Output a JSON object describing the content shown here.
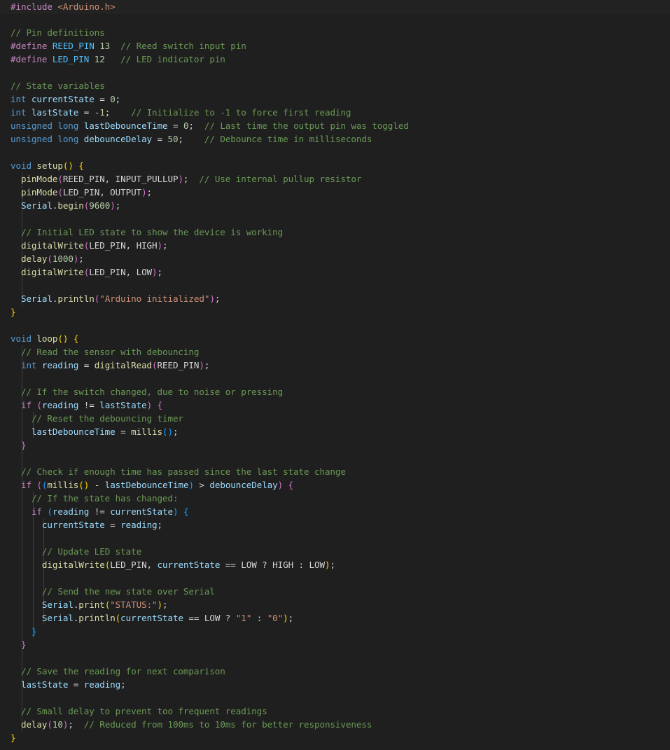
{
  "editor": {
    "file_language": "cpp",
    "lines": [
      [
        [
          "pp",
          "#include "
        ],
        [
          "str",
          "<Arduino.h>"
        ]
      ],
      [],
      [
        [
          "cm",
          "// Pin definitions"
        ]
      ],
      [
        [
          "pp",
          "#define "
        ],
        [
          "def",
          "REED_PIN"
        ],
        [
          "plain",
          " "
        ],
        [
          "num",
          "13"
        ],
        [
          "plain",
          "  "
        ],
        [
          "cm",
          "// Reed switch input pin"
        ]
      ],
      [
        [
          "pp",
          "#define "
        ],
        [
          "def",
          "LED_PIN"
        ],
        [
          "plain",
          " "
        ],
        [
          "num",
          "12"
        ],
        [
          "plain",
          "   "
        ],
        [
          "cm",
          "// LED indicator pin"
        ]
      ],
      [],
      [
        [
          "cm",
          "// State variables"
        ]
      ],
      [
        [
          "kw",
          "int"
        ],
        [
          "plain",
          " "
        ],
        [
          "var",
          "currentState"
        ],
        [
          "plain",
          " = "
        ],
        [
          "num",
          "0"
        ],
        [
          "plain",
          ";"
        ]
      ],
      [
        [
          "kw",
          "int"
        ],
        [
          "plain",
          " "
        ],
        [
          "var",
          "lastState"
        ],
        [
          "plain",
          " = -"
        ],
        [
          "num",
          "1"
        ],
        [
          "plain",
          ";    "
        ],
        [
          "cm",
          "// Initialize to -1 to force first reading"
        ]
      ],
      [
        [
          "kw",
          "unsigned long"
        ],
        [
          "plain",
          " "
        ],
        [
          "var",
          "lastDebounceTime"
        ],
        [
          "plain",
          " = "
        ],
        [
          "num",
          "0"
        ],
        [
          "plain",
          ";  "
        ],
        [
          "cm",
          "// Last time the output pin was toggled"
        ]
      ],
      [
        [
          "kw",
          "unsigned long"
        ],
        [
          "plain",
          " "
        ],
        [
          "var",
          "debounceDelay"
        ],
        [
          "plain",
          " = "
        ],
        [
          "num",
          "50"
        ],
        [
          "plain",
          ";    "
        ],
        [
          "cm",
          "// Debounce time in milliseconds"
        ]
      ],
      [],
      [
        [
          "kw",
          "void"
        ],
        [
          "plain",
          " "
        ],
        [
          "fn",
          "setup"
        ],
        [
          "p1",
          "()"
        ],
        [
          "plain",
          " "
        ],
        [
          "p1",
          "{"
        ]
      ],
      [
        [
          "plain",
          "  "
        ],
        [
          "fn",
          "pinMode"
        ],
        [
          "p2",
          "("
        ],
        [
          "plain",
          "REED_PIN, INPUT_PULLUP"
        ],
        [
          "p2",
          ")"
        ],
        [
          "plain",
          ";  "
        ],
        [
          "cm",
          "// Use internal pullup resistor"
        ]
      ],
      [
        [
          "plain",
          "  "
        ],
        [
          "fn",
          "pinMode"
        ],
        [
          "p2",
          "("
        ],
        [
          "plain",
          "LED_PIN, OUTPUT"
        ],
        [
          "p2",
          ")"
        ],
        [
          "plain",
          ";"
        ]
      ],
      [
        [
          "plain",
          "  "
        ],
        [
          "var",
          "Serial"
        ],
        [
          "plain",
          "."
        ],
        [
          "fn",
          "begin"
        ],
        [
          "p2",
          "("
        ],
        [
          "num",
          "9600"
        ],
        [
          "p2",
          ")"
        ],
        [
          "plain",
          ";"
        ]
      ],
      [],
      [
        [
          "plain",
          "  "
        ],
        [
          "cm",
          "// Initial LED state to show the device is working"
        ]
      ],
      [
        [
          "plain",
          "  "
        ],
        [
          "fn",
          "digitalWrite"
        ],
        [
          "p2",
          "("
        ],
        [
          "plain",
          "LED_PIN, HIGH"
        ],
        [
          "p2",
          ")"
        ],
        [
          "plain",
          ";"
        ]
      ],
      [
        [
          "plain",
          "  "
        ],
        [
          "fn",
          "delay"
        ],
        [
          "p2",
          "("
        ],
        [
          "num",
          "1000"
        ],
        [
          "p2",
          ")"
        ],
        [
          "plain",
          ";"
        ]
      ],
      [
        [
          "plain",
          "  "
        ],
        [
          "fn",
          "digitalWrite"
        ],
        [
          "p2",
          "("
        ],
        [
          "plain",
          "LED_PIN, LOW"
        ],
        [
          "p2",
          ")"
        ],
        [
          "plain",
          ";"
        ]
      ],
      [],
      [
        [
          "plain",
          "  "
        ],
        [
          "var",
          "Serial"
        ],
        [
          "plain",
          "."
        ],
        [
          "fn",
          "println"
        ],
        [
          "p2",
          "("
        ],
        [
          "str",
          "\"Arduino initialized\""
        ],
        [
          "p2",
          ")"
        ],
        [
          "plain",
          ";"
        ]
      ],
      [
        [
          "p1",
          "}"
        ]
      ],
      [],
      [
        [
          "kw",
          "void"
        ],
        [
          "plain",
          " "
        ],
        [
          "fn",
          "loop"
        ],
        [
          "p1",
          "()"
        ],
        [
          "plain",
          " "
        ],
        [
          "p1",
          "{"
        ]
      ],
      [
        [
          "plain",
          "  "
        ],
        [
          "cm",
          "// Read the sensor with debouncing"
        ]
      ],
      [
        [
          "plain",
          "  "
        ],
        [
          "kw",
          "int"
        ],
        [
          "plain",
          " "
        ],
        [
          "var",
          "reading"
        ],
        [
          "plain",
          " = "
        ],
        [
          "fn",
          "digitalRead"
        ],
        [
          "p2",
          "("
        ],
        [
          "plain",
          "REED_PIN"
        ],
        [
          "p2",
          ")"
        ],
        [
          "plain",
          ";"
        ]
      ],
      [],
      [
        [
          "plain",
          "  "
        ],
        [
          "cm",
          "// If the switch changed, due to noise or pressing"
        ]
      ],
      [
        [
          "plain",
          "  "
        ],
        [
          "pp",
          "if"
        ],
        [
          "plain",
          " "
        ],
        [
          "p2",
          "("
        ],
        [
          "var",
          "reading"
        ],
        [
          "plain",
          " != "
        ],
        [
          "var",
          "lastState"
        ],
        [
          "p2",
          ")"
        ],
        [
          "plain",
          " "
        ],
        [
          "p2",
          "{"
        ]
      ],
      [
        [
          "plain",
          "    "
        ],
        [
          "cm",
          "// Reset the debouncing timer"
        ]
      ],
      [
        [
          "plain",
          "    "
        ],
        [
          "var",
          "lastDebounceTime"
        ],
        [
          "plain",
          " = "
        ],
        [
          "fn",
          "millis"
        ],
        [
          "p3",
          "()"
        ],
        [
          "plain",
          ";"
        ]
      ],
      [
        [
          "plain",
          "  "
        ],
        [
          "p2",
          "}"
        ]
      ],
      [],
      [
        [
          "plain",
          "  "
        ],
        [
          "cm",
          "// Check if enough time has passed since the last state change"
        ]
      ],
      [
        [
          "plain",
          "  "
        ],
        [
          "pp",
          "if"
        ],
        [
          "plain",
          " "
        ],
        [
          "p2",
          "("
        ],
        [
          "p3",
          "("
        ],
        [
          "fn",
          "millis"
        ],
        [
          "p1",
          "()"
        ],
        [
          "plain",
          " - "
        ],
        [
          "var",
          "lastDebounceTime"
        ],
        [
          "p3",
          ")"
        ],
        [
          "plain",
          " > "
        ],
        [
          "var",
          "debounceDelay"
        ],
        [
          "p2",
          ")"
        ],
        [
          "plain",
          " "
        ],
        [
          "p2",
          "{"
        ]
      ],
      [
        [
          "plain",
          "    "
        ],
        [
          "cm",
          "// If the state has changed:"
        ]
      ],
      [
        [
          "plain",
          "    "
        ],
        [
          "pp",
          "if"
        ],
        [
          "plain",
          " "
        ],
        [
          "p3",
          "("
        ],
        [
          "var",
          "reading"
        ],
        [
          "plain",
          " != "
        ],
        [
          "var",
          "currentState"
        ],
        [
          "p3",
          ")"
        ],
        [
          "plain",
          " "
        ],
        [
          "p3",
          "{"
        ]
      ],
      [
        [
          "plain",
          "      "
        ],
        [
          "var",
          "currentState"
        ],
        [
          "plain",
          " = "
        ],
        [
          "var",
          "reading"
        ],
        [
          "plain",
          ";"
        ]
      ],
      [],
      [
        [
          "plain",
          "      "
        ],
        [
          "cm",
          "// Update LED state"
        ]
      ],
      [
        [
          "plain",
          "      "
        ],
        [
          "fn",
          "digitalWrite"
        ],
        [
          "p1",
          "("
        ],
        [
          "plain",
          "LED_PIN, "
        ],
        [
          "var",
          "currentState"
        ],
        [
          "plain",
          " == LOW ? HIGH : LOW"
        ],
        [
          "p1",
          ")"
        ],
        [
          "plain",
          ";"
        ]
      ],
      [],
      [
        [
          "plain",
          "      "
        ],
        [
          "cm",
          "// Send the new state over Serial"
        ]
      ],
      [
        [
          "plain",
          "      "
        ],
        [
          "var",
          "Serial"
        ],
        [
          "plain",
          "."
        ],
        [
          "fn",
          "print"
        ],
        [
          "p1",
          "("
        ],
        [
          "str",
          "\"STATUS:\""
        ],
        [
          "p1",
          ")"
        ],
        [
          "plain",
          ";"
        ]
      ],
      [
        [
          "plain",
          "      "
        ],
        [
          "var",
          "Serial"
        ],
        [
          "plain",
          "."
        ],
        [
          "fn",
          "println"
        ],
        [
          "p1",
          "("
        ],
        [
          "var",
          "currentState"
        ],
        [
          "plain",
          " == LOW ? "
        ],
        [
          "str",
          "\"1\""
        ],
        [
          "plain",
          " : "
        ],
        [
          "str",
          "\"0\""
        ],
        [
          "p1",
          ")"
        ],
        [
          "plain",
          ";"
        ]
      ],
      [
        [
          "plain",
          "    "
        ],
        [
          "p3",
          "}"
        ]
      ],
      [
        [
          "plain",
          "  "
        ],
        [
          "p2",
          "}"
        ]
      ],
      [],
      [
        [
          "plain",
          "  "
        ],
        [
          "cm",
          "// Save the reading for next comparison"
        ]
      ],
      [
        [
          "plain",
          "  "
        ],
        [
          "var",
          "lastState"
        ],
        [
          "plain",
          " = "
        ],
        [
          "var",
          "reading"
        ],
        [
          "plain",
          ";"
        ]
      ],
      [],
      [
        [
          "plain",
          "  "
        ],
        [
          "cm",
          "// Small delay to prevent too frequent readings"
        ]
      ],
      [
        [
          "plain",
          "  "
        ],
        [
          "fn",
          "delay"
        ],
        [
          "p2",
          "("
        ],
        [
          "num",
          "10"
        ],
        [
          "p2",
          ")"
        ],
        [
          "plain",
          ";  "
        ],
        [
          "cm",
          "// Reduced from 100ms to 10ms for better responsiveness"
        ]
      ],
      [
        [
          "p1",
          "}"
        ]
      ]
    ],
    "colors": {
      "background": "#1f1f1f",
      "comment": "#6a9955",
      "keyword": "#569cd6",
      "preprocessor": "#c586c0",
      "function": "#dcdcaa",
      "string": "#ce9178",
      "number": "#b5cea8",
      "variable": "#9cdcfe",
      "bracket_level1": "#ffd700",
      "bracket_level2": "#da70d6",
      "bracket_level3": "#179fff"
    }
  }
}
